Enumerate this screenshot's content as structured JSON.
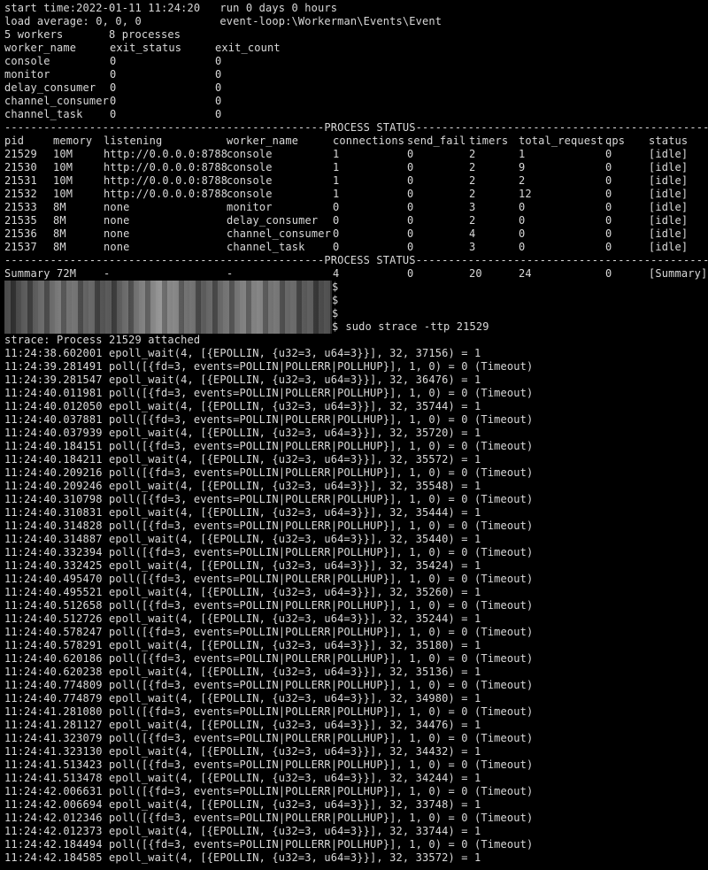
{
  "header": {
    "start_line": "start time:2022-01-11 11:24:20   run 0 days 0 hours",
    "load_line": "load average: 0, 0, 0            event-loop:\\Workerman\\Events\\Event",
    "summary_line": "5 workers       8 processes"
  },
  "worker_table": {
    "columns": [
      "worker_name",
      "exit_status",
      "exit_count"
    ],
    "rows": [
      [
        "console",
        "0",
        "0"
      ],
      [
        "monitor",
        "0",
        "0"
      ],
      [
        "delay_consumer",
        "0",
        "0"
      ],
      [
        "channel_consumer",
        "0",
        "0"
      ],
      [
        "channel_task",
        "0",
        "0"
      ]
    ]
  },
  "process_status": {
    "separator_top": "-------------------------------------------------PROCESS STATUS-------------------------------------------------",
    "separator_bottom": "-------------------------------------------------PROCESS STATUS-------------------------------------------------",
    "columns": [
      "pid",
      "memory",
      "listening",
      "worker_name",
      "connections",
      "send_fail",
      "timers",
      "total_request",
      "qps",
      "status"
    ],
    "rows": [
      [
        "21529",
        "10M",
        "http://0.0.0.0:8788",
        "console",
        "1",
        "0",
        "2",
        "1",
        "0",
        "[idle]"
      ],
      [
        "21530",
        "10M",
        "http://0.0.0.0:8788",
        "console",
        "1",
        "0",
        "2",
        "9",
        "0",
        "[idle]"
      ],
      [
        "21531",
        "10M",
        "http://0.0.0.0:8788",
        "console",
        "1",
        "0",
        "2",
        "2",
        "0",
        "[idle]"
      ],
      [
        "21532",
        "10M",
        "http://0.0.0.0:8788",
        "console",
        "1",
        "0",
        "2",
        "12",
        "0",
        "[idle]"
      ],
      [
        "21533",
        "8M",
        "none",
        "monitor",
        "0",
        "0",
        "3",
        "0",
        "0",
        "[idle]"
      ],
      [
        "21535",
        "8M",
        "none",
        "delay_consumer",
        "0",
        "0",
        "2",
        "0",
        "0",
        "[idle]"
      ],
      [
        "21536",
        "8M",
        "none",
        "channel_consumer",
        "0",
        "0",
        "4",
        "0",
        "0",
        "[idle]"
      ],
      [
        "21537",
        "8M",
        "none",
        "channel_task",
        "0",
        "0",
        "3",
        "0",
        "0",
        "[idle]"
      ]
    ],
    "summary": [
      "Summary 72M",
      "-",
      "-",
      "4",
      "0",
      "20",
      "24",
      "0",
      "[Summary]"
    ]
  },
  "prompts": [
    {
      "suffix": "$",
      "command": ""
    },
    {
      "suffix": "$",
      "command": ""
    },
    {
      "suffix": "$",
      "command": ""
    },
    {
      "suffix": "$",
      "command": " sudo strace -ttp 21529"
    }
  ],
  "strace": {
    "attached": "strace: Process 21529 attached",
    "lines": [
      "11:24:38.602001 epoll_wait(4, [{EPOLLIN, {u32=3, u64=3}}], 32, 37156) = 1",
      "11:24:39.281491 poll([{fd=3, events=POLLIN|POLLERR|POLLHUP}], 1, 0) = 0 (Timeout)",
      "11:24:39.281547 epoll_wait(4, [{EPOLLIN, {u32=3, u64=3}}], 32, 36476) = 1",
      "11:24:40.011981 poll([{fd=3, events=POLLIN|POLLERR|POLLHUP}], 1, 0) = 0 (Timeout)",
      "11:24:40.012050 epoll_wait(4, [{EPOLLIN, {u32=3, u64=3}}], 32, 35744) = 1",
      "11:24:40.037881 poll([{fd=3, events=POLLIN|POLLERR|POLLHUP}], 1, 0) = 0 (Timeout)",
      "11:24:40.037939 epoll_wait(4, [{EPOLLIN, {u32=3, u64=3}}], 32, 35720) = 1",
      "11:24:40.184151 poll([{fd=3, events=POLLIN|POLLERR|POLLHUP}], 1, 0) = 0 (Timeout)",
      "11:24:40.184211 epoll_wait(4, [{EPOLLIN, {u32=3, u64=3}}], 32, 35572) = 1",
      "11:24:40.209216 poll([{fd=3, events=POLLIN|POLLERR|POLLHUP}], 1, 0) = 0 (Timeout)",
      "11:24:40.209246 epoll_wait(4, [{EPOLLIN, {u32=3, u64=3}}], 32, 35548) = 1",
      "11:24:40.310798 poll([{fd=3, events=POLLIN|POLLERR|POLLHUP}], 1, 0) = 0 (Timeout)",
      "11:24:40.310831 epoll_wait(4, [{EPOLLIN, {u32=3, u64=3}}], 32, 35444) = 1",
      "11:24:40.314828 poll([{fd=3, events=POLLIN|POLLERR|POLLHUP}], 1, 0) = 0 (Timeout)",
      "11:24:40.314887 epoll_wait(4, [{EPOLLIN, {u32=3, u64=3}}], 32, 35440) = 1",
      "11:24:40.332394 poll([{fd=3, events=POLLIN|POLLERR|POLLHUP}], 1, 0) = 0 (Timeout)",
      "11:24:40.332425 epoll_wait(4, [{EPOLLIN, {u32=3, u64=3}}], 32, 35424) = 1",
      "11:24:40.495470 poll([{fd=3, events=POLLIN|POLLERR|POLLHUP}], 1, 0) = 0 (Timeout)",
      "11:24:40.495521 epoll_wait(4, [{EPOLLIN, {u32=3, u64=3}}], 32, 35260) = 1",
      "11:24:40.512658 poll([{fd=3, events=POLLIN|POLLERR|POLLHUP}], 1, 0) = 0 (Timeout)",
      "11:24:40.512726 epoll_wait(4, [{EPOLLIN, {u32=3, u64=3}}], 32, 35244) = 1",
      "11:24:40.578247 poll([{fd=3, events=POLLIN|POLLERR|POLLHUP}], 1, 0) = 0 (Timeout)",
      "11:24:40.578291 epoll_wait(4, [{EPOLLIN, {u32=3, u64=3}}], 32, 35180) = 1",
      "11:24:40.620186 poll([{fd=3, events=POLLIN|POLLERR|POLLHUP}], 1, 0) = 0 (Timeout)",
      "11:24:40.620238 epoll_wait(4, [{EPOLLIN, {u32=3, u64=3}}], 32, 35136) = 1",
      "11:24:40.774809 poll([{fd=3, events=POLLIN|POLLERR|POLLHUP}], 1, 0) = 0 (Timeout)",
      "11:24:40.774879 epoll_wait(4, [{EPOLLIN, {u32=3, u64=3}}], 32, 34980) = 1",
      "11:24:41.281080 poll([{fd=3, events=POLLIN|POLLERR|POLLHUP}], 1, 0) = 0 (Timeout)",
      "11:24:41.281127 epoll_wait(4, [{EPOLLIN, {u32=3, u64=3}}], 32, 34476) = 1",
      "11:24:41.323079 poll([{fd=3, events=POLLIN|POLLERR|POLLHUP}], 1, 0) = 0 (Timeout)",
      "11:24:41.323130 epoll_wait(4, [{EPOLLIN, {u32=3, u64=3}}], 32, 34432) = 1",
      "11:24:41.513423 poll([{fd=3, events=POLLIN|POLLERR|POLLHUP}], 1, 0) = 0 (Timeout)",
      "11:24:41.513478 epoll_wait(4, [{EPOLLIN, {u32=3, u64=3}}], 32, 34244) = 1",
      "11:24:42.006631 poll([{fd=3, events=POLLIN|POLLERR|POLLHUP}], 1, 0) = 0 (Timeout)",
      "11:24:42.006694 epoll_wait(4, [{EPOLLIN, {u32=3, u64=3}}], 32, 33748) = 1",
      "11:24:42.012346 poll([{fd=3, events=POLLIN|POLLERR|POLLHUP}], 1, 0) = 0 (Timeout)",
      "11:24:42.012373 epoll_wait(4, [{EPOLLIN, {u32=3, u64=3}}], 32, 33744) = 1",
      "11:24:42.184494 poll([{fd=3, events=POLLIN|POLLERR|POLLHUP}], 1, 0) = 0 (Timeout)",
      "11:24:42.184585 epoll_wait(4, [{EPOLLIN, {u32=3, u64=3}}], 32, 33572) = 1"
    ]
  }
}
